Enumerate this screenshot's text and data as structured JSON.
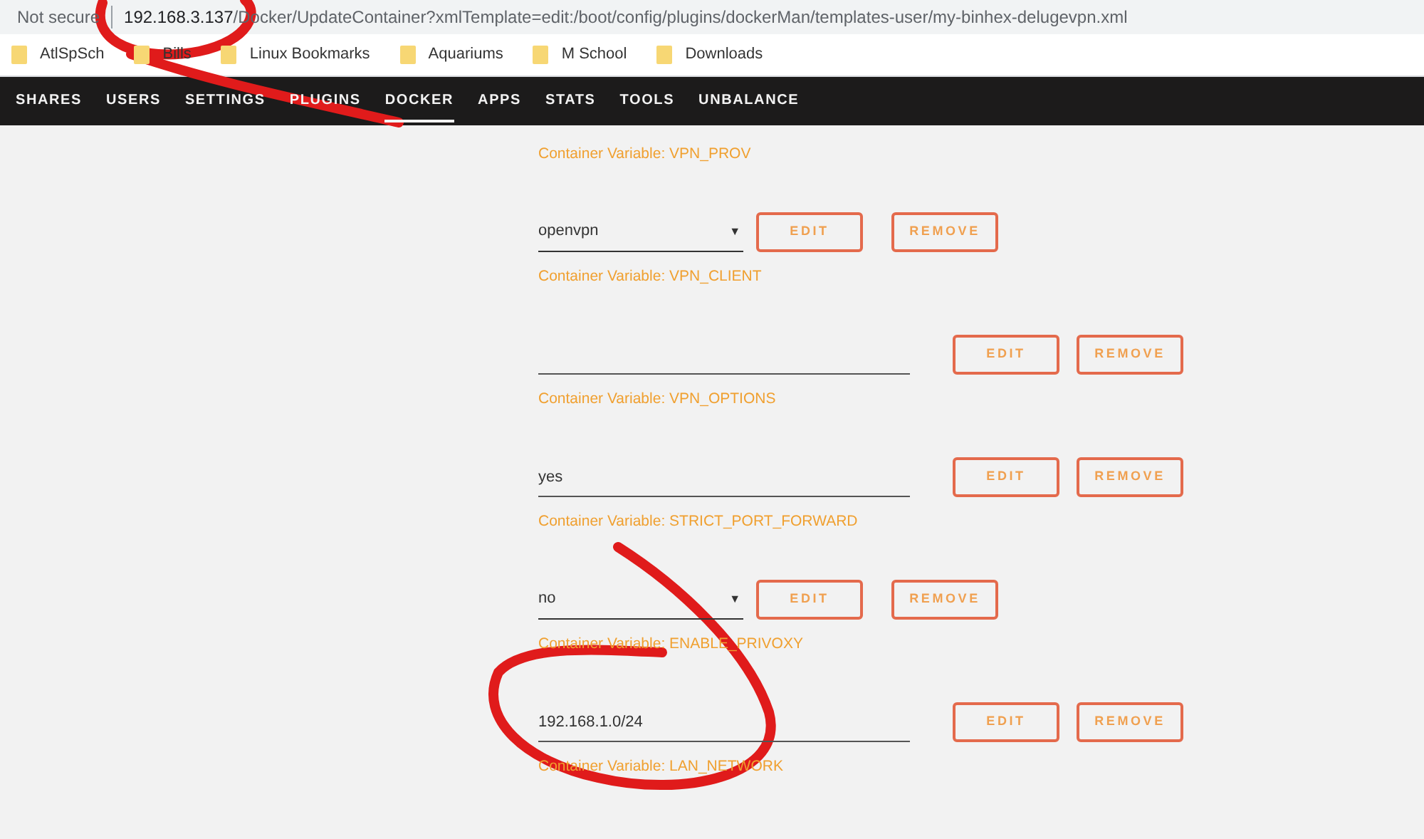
{
  "address_bar": {
    "security": "Not secure",
    "url_host": "192.168.3.137",
    "url_path": "/Docker/UpdateContainer?xmlTemplate=edit:/boot/config/plugins/dockerMan/templates-user/my-binhex-delugevpn.xml"
  },
  "bookmarks": [
    "AtlSpSch",
    "Bills",
    "Linux Bookmarks",
    "Aquariums",
    "M School",
    "Downloads"
  ],
  "nav": [
    {
      "label": "SHARES",
      "selected": false
    },
    {
      "label": "USERS",
      "selected": false
    },
    {
      "label": "SETTINGS",
      "selected": false
    },
    {
      "label": "PLUGINS",
      "selected": false
    },
    {
      "label": "DOCKER",
      "selected": true
    },
    {
      "label": "APPS",
      "selected": false
    },
    {
      "label": "STATS",
      "selected": false
    },
    {
      "label": "TOOLS",
      "selected": false
    },
    {
      "label": "UNBALANCE",
      "selected": false
    }
  ],
  "top_label": "Container Variable: VPN_PROV",
  "variables": [
    {
      "kind": "select",
      "value": "openvpn",
      "arrow": "▼",
      "edit": "EDIT",
      "remove": "REMOVE",
      "label": "Container Variable: VPN_CLIENT"
    },
    {
      "kind": "text",
      "edit": "EDIT",
      "remove": "REMOVE",
      "label": "Container Variable: VPN_OPTIONS"
    },
    {
      "kind": "text",
      "value": "yes",
      "edit": "EDIT",
      "remove": "REMOVE",
      "label": "Container Variable: STRICT_PORT_FORWARD"
    },
    {
      "kind": "select",
      "value": "no",
      "arrow": "▼",
      "edit": "EDIT",
      "remove": "REMOVE",
      "label": "Container Variable: ENABLE_PRIVOXY"
    },
    {
      "kind": "text",
      "value": "192.168.1.0/24",
      "edit": "EDIT",
      "remove": "REMOVE",
      "label": "Container Variable: LAN_NETWORK"
    }
  ]
}
